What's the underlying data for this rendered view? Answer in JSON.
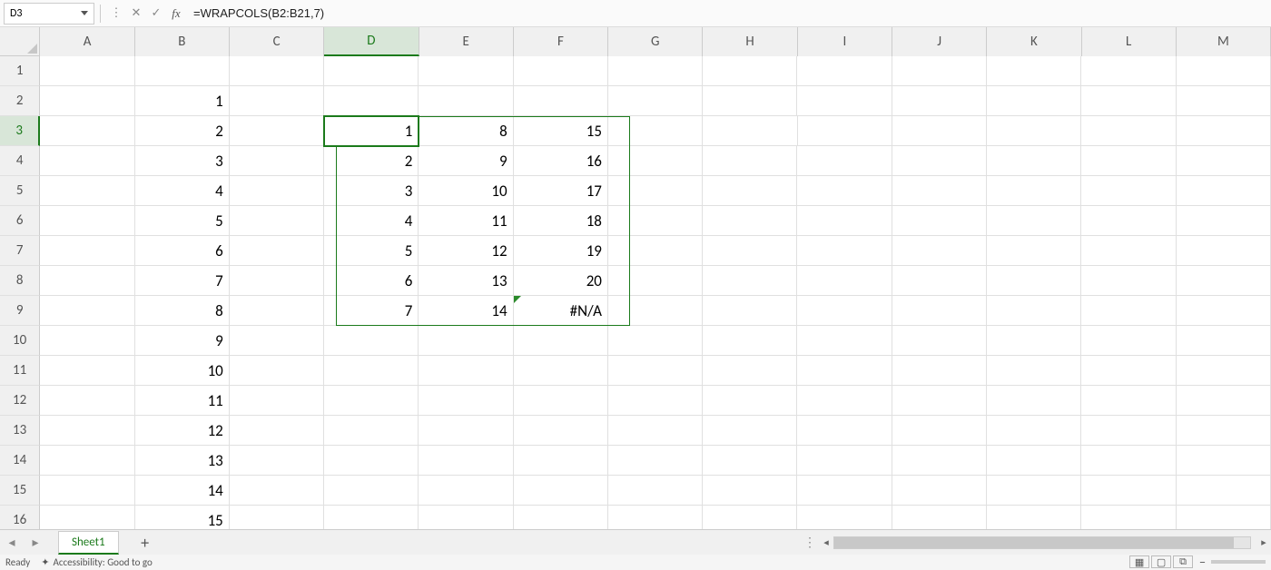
{
  "namebox": {
    "value": "D3"
  },
  "formula_bar": {
    "value": "=WRAPCOLS(B2:B21,7)"
  },
  "columns": [
    "A",
    "B",
    "C",
    "D",
    "E",
    "F",
    "G",
    "H",
    "I",
    "J",
    "K",
    "L",
    "M"
  ],
  "selected_col": "D",
  "row_count": 16,
  "selected_row": 3,
  "active_cell": {
    "col": "D",
    "row": 3
  },
  "spill_range": {
    "col_start": "D",
    "row_start": 3,
    "col_end": "F",
    "row_end": 9
  },
  "error_flag_cell": {
    "col": "F",
    "row": 9
  },
  "cells": {
    "B2": "1",
    "B3": "2",
    "B4": "3",
    "B5": "4",
    "B6": "5",
    "B7": "6",
    "B8": "7",
    "B9": "8",
    "B10": "9",
    "B11": "10",
    "B12": "11",
    "B13": "12",
    "B14": "13",
    "B15": "14",
    "B16": "15",
    "D3": "1",
    "D4": "2",
    "D5": "3",
    "D6": "4",
    "D7": "5",
    "D8": "6",
    "D9": "7",
    "E3": "8",
    "E4": "9",
    "E5": "10",
    "E6": "11",
    "E7": "12",
    "E8": "13",
    "E9": "14",
    "F3": "15",
    "F4": "16",
    "F5": "17",
    "F6": "18",
    "F7": "19",
    "F8": "20",
    "F9": "#N/A"
  },
  "sheet": {
    "active_tab": "Sheet1",
    "add_label": "+"
  },
  "status_bar": {
    "ready": "Ready",
    "accessibility": "Accessibility: Good to go"
  }
}
